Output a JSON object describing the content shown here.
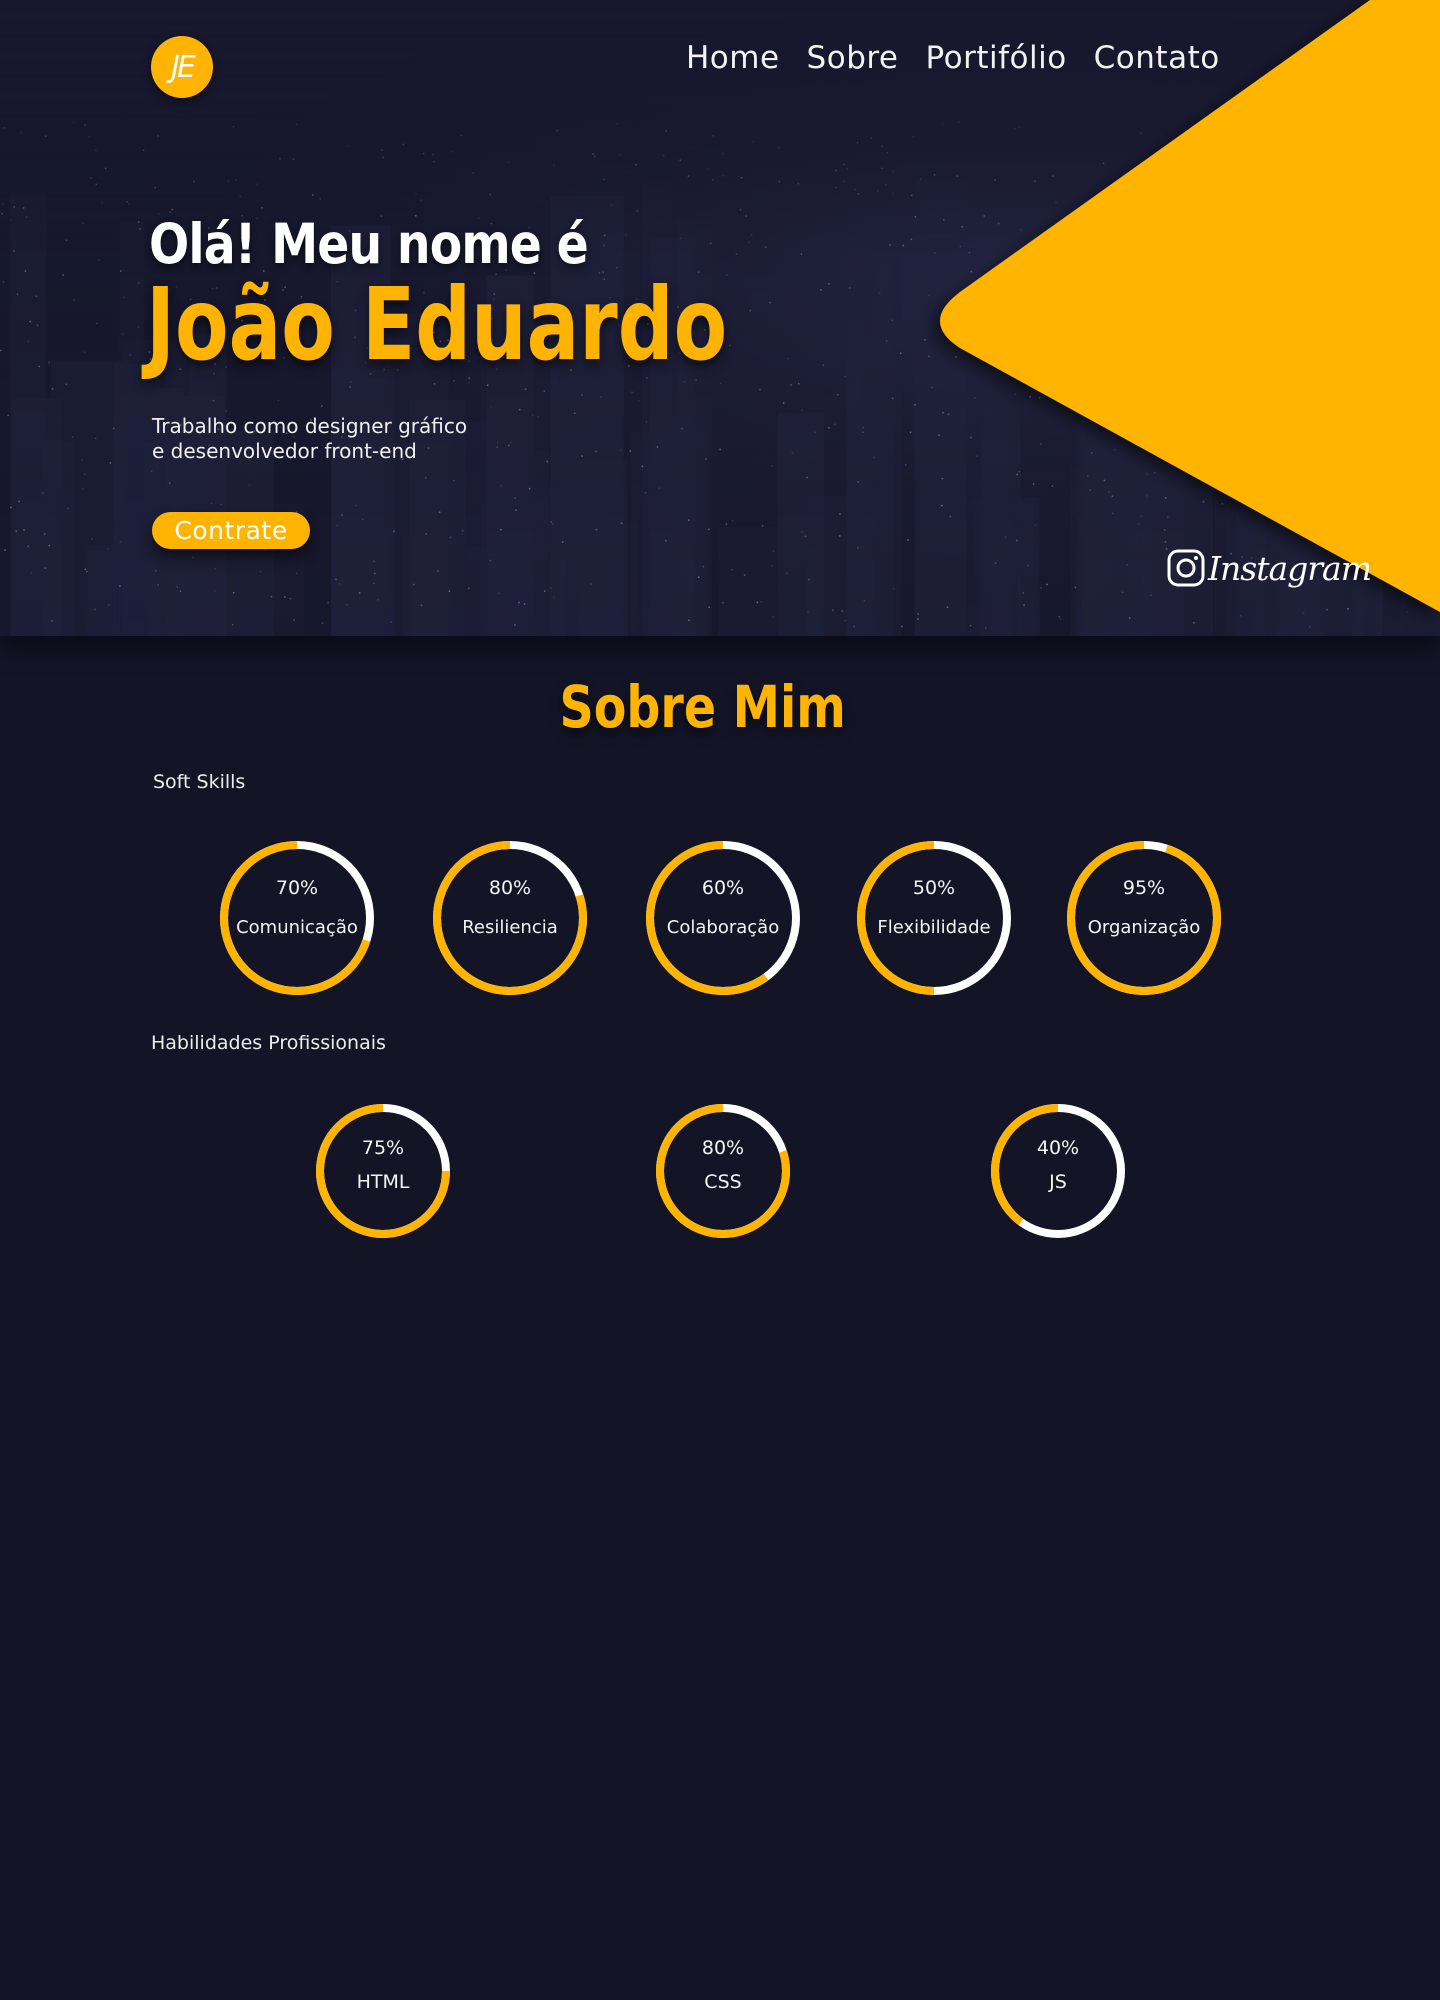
{
  "header": {
    "logo_text": "JE",
    "nav": [
      {
        "label": "Home"
      },
      {
        "label": "Sobre"
      },
      {
        "label": "Portifólio"
      },
      {
        "label": "Contato"
      }
    ]
  },
  "hero": {
    "greeting": "Olá! Meu nome é",
    "name": "João Eduardo",
    "bio_line1": "Trabalho como designer gráfico",
    "bio_line2": "e desenvolvedor front-end",
    "cta_label": "Contrate",
    "instagram_label": "Instagram"
  },
  "about": {
    "title": "Sobre Mim",
    "soft_skills_label": "Soft Skills",
    "soft_skills": [
      {
        "percent": "70%",
        "label": "Comunicação",
        "value": 70
      },
      {
        "percent": "80%",
        "label": "Resiliencia",
        "value": 80
      },
      {
        "percent": "60%",
        "label": "Colaboração",
        "value": 60
      },
      {
        "percent": "50%",
        "label": "Flexibilidade",
        "value": 50
      },
      {
        "percent": "95%",
        "label": "Organização",
        "value": 95
      }
    ],
    "pro_skills_label": "Habilidades Profissionais",
    "pro_skills": [
      {
        "percent": "75%",
        "label": "HTML",
        "value": 75
      },
      {
        "percent": "80%",
        "label": "CSS",
        "value": 80
      },
      {
        "percent": "40%",
        "label": "JS",
        "value": 40
      }
    ]
  },
  "colors": {
    "accent": "#ffb404",
    "background": "#131527",
    "ring_track": "#ffffff"
  }
}
